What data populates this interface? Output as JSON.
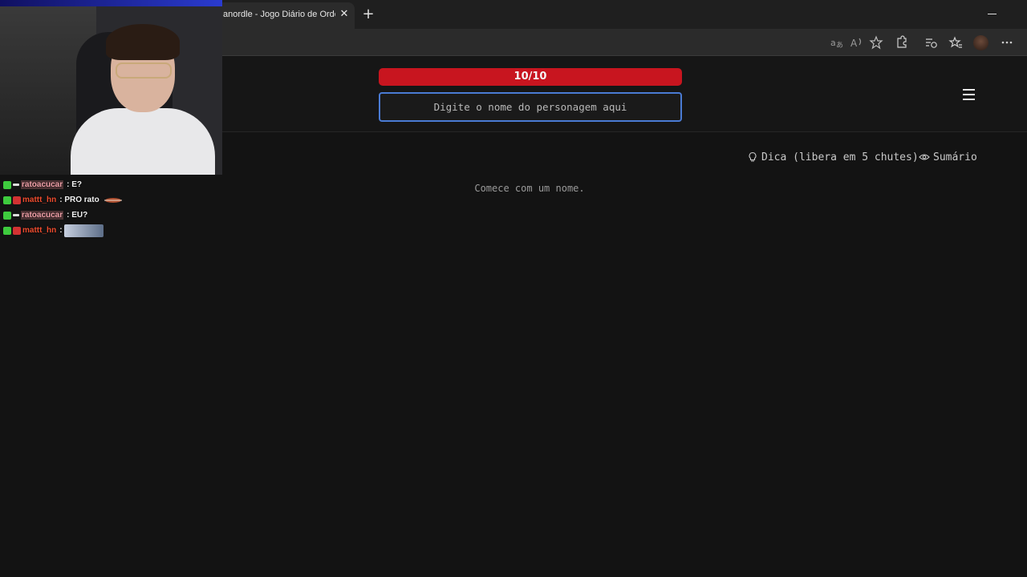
{
  "browser": {
    "tab_title": "anordle - Jogo Diário de Ordem",
    "tab_close": "✕",
    "new_tab": "+"
  },
  "header": {
    "counter": "10/10",
    "search_placeholder": "Digite o nome do personagem aqui"
  },
  "actions": {
    "hint_label": "Dica (libera em 5 chutes)",
    "summary_label": "Sumário"
  },
  "main": {
    "start_message": "Comece com um nome."
  },
  "chat": {
    "messages": [
      {
        "user": "ratoacucar",
        "text": "E?"
      },
      {
        "user": "mattt_hn",
        "text": "PRO rato"
      },
      {
        "user": "ratoacucar",
        "text": "EU?"
      },
      {
        "user": "mattt_hn",
        "text": ""
      }
    ]
  },
  "colors": {
    "counter_bg": "#c8151f",
    "input_border": "#4a7bd4",
    "page_bg": "#131313"
  }
}
